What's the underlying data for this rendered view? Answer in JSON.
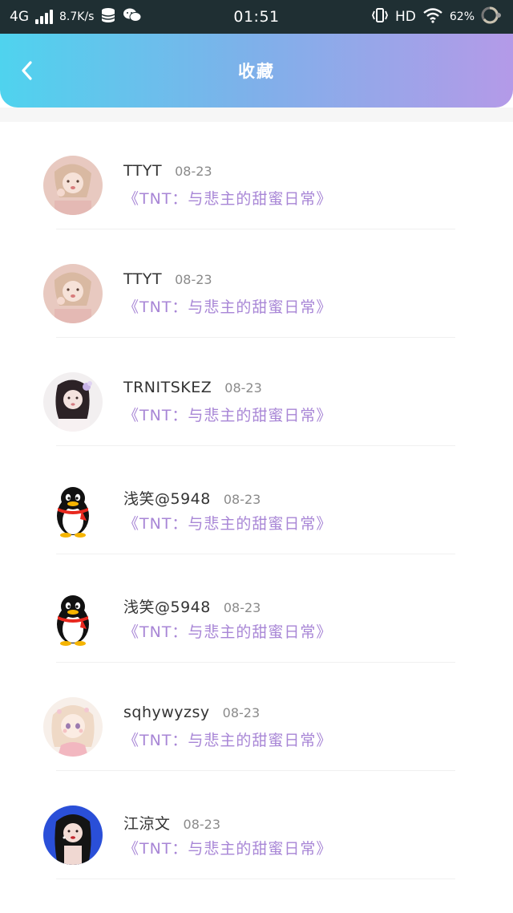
{
  "status_bar": {
    "network": "4G",
    "speed": "8.7K/s",
    "time": "01:51",
    "hd": "HD",
    "battery": "62%"
  },
  "header": {
    "title": "收藏",
    "back_icon": "chevron-left-icon",
    "gradient_start": "#4fd3ee",
    "gradient_end": "#b49ae8"
  },
  "colors": {
    "accent_title": "#a886d6",
    "name_text": "#333333",
    "date_text": "#8a8a8a"
  },
  "items": [
    {
      "name": "TTYT",
      "date": "08-23",
      "title": "《TNT：与悲主的甜蜜日常》",
      "avatar": "photo-avatar-girl-pink"
    },
    {
      "name": "TTYT",
      "date": "08-23",
      "title": "《TNT：与悲主的甜蜜日常》",
      "avatar": "photo-avatar-girl-pink"
    },
    {
      "name": "TRNITSKEZ",
      "date": "08-23",
      "title": "《TNT：与悲主的甜蜜日常》",
      "avatar": "photo-avatar-girl-white"
    },
    {
      "name": "浅笑@5948",
      "date": "08-23",
      "title": "《TNT：与悲主的甜蜜日常》",
      "avatar": "qq-penguin-avatar"
    },
    {
      "name": "浅笑@5948",
      "date": "08-23",
      "title": "《TNT：与悲主的甜蜜日常》",
      "avatar": "qq-penguin-avatar"
    },
    {
      "name": "sqhywyzsy",
      "date": "08-23",
      "title": "《TNT：与悲主的甜蜜日常》",
      "avatar": "anime-avatar-girl"
    },
    {
      "name": "江涼文",
      "date": "08-23",
      "title": "《TNT：与悲主的甜蜜日常》",
      "avatar": "photo-avatar-girl-blue"
    }
  ]
}
